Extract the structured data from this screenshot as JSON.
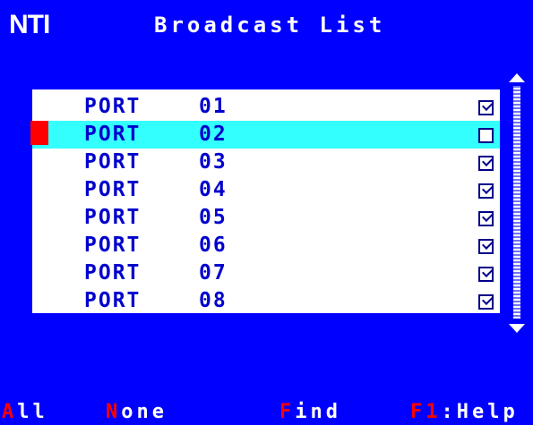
{
  "header": {
    "logo": "NTI",
    "title": "Broadcast List"
  },
  "list": {
    "selected_index": 1,
    "rows": [
      {
        "label": "PORT",
        "number": "01",
        "checked": true
      },
      {
        "label": "PORT",
        "number": "02",
        "checked": false
      },
      {
        "label": "PORT",
        "number": "03",
        "checked": true
      },
      {
        "label": "PORT",
        "number": "04",
        "checked": true
      },
      {
        "label": "PORT",
        "number": "05",
        "checked": true
      },
      {
        "label": "PORT",
        "number": "06",
        "checked": true
      },
      {
        "label": "PORT",
        "number": "07",
        "checked": true
      },
      {
        "label": "PORT",
        "number": "08",
        "checked": true
      }
    ]
  },
  "footer": {
    "all": {
      "key": "A",
      "rest": "ll"
    },
    "none": {
      "key": "N",
      "rest": "one"
    },
    "find": {
      "key": "F",
      "rest": "ind"
    },
    "help": {
      "key": "F1",
      "rest": ":Help"
    }
  },
  "colors": {
    "background": "#0000ff",
    "list_bg": "#ffffff",
    "selected_row": "#33ffff",
    "hotkey": "#ff0000",
    "text": "#0000cc"
  }
}
